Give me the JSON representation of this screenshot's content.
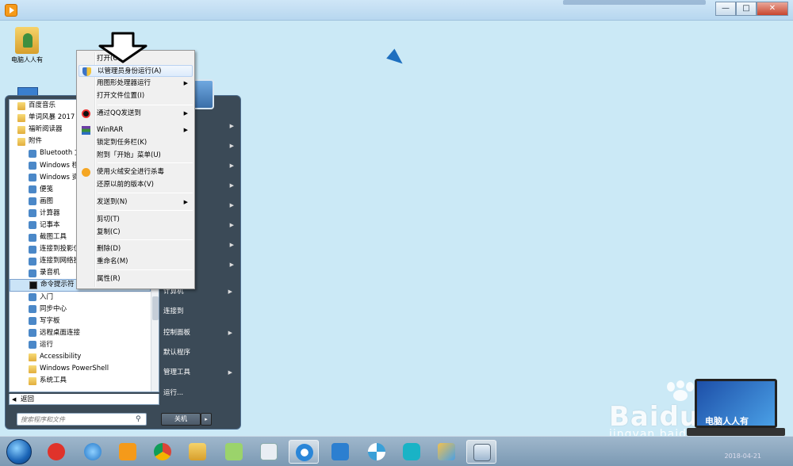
{
  "window": {
    "minimize_label": "—",
    "maximize_label": "□",
    "close_label": "✕"
  },
  "desktop": {
    "icon_label": "电脑人人有"
  },
  "start_menu": {
    "programs": [
      {
        "label": "百度音乐",
        "type": "folder",
        "level": 0
      },
      {
        "label": "单词风暴 2017",
        "type": "folder",
        "level": 0
      },
      {
        "label": "福昕阅读器",
        "type": "folder",
        "level": 0
      },
      {
        "label": "附件",
        "type": "folder",
        "level": 0
      },
      {
        "label": "Bluetooth 文",
        "type": "app",
        "level": 1
      },
      {
        "label": "Windows 移",
        "type": "app",
        "level": 1
      },
      {
        "label": "Windows 资",
        "type": "app",
        "level": 1
      },
      {
        "label": "便笺",
        "type": "app",
        "level": 1
      },
      {
        "label": "画图",
        "type": "app",
        "level": 1
      },
      {
        "label": "计算器",
        "type": "app",
        "level": 1
      },
      {
        "label": "记事本",
        "type": "app",
        "level": 1
      },
      {
        "label": "截图工具",
        "type": "app",
        "level": 1
      },
      {
        "label": "连接到投影仪",
        "type": "app",
        "level": 1
      },
      {
        "label": "连接到网络投",
        "type": "app",
        "level": 1
      },
      {
        "label": "录音机",
        "type": "app",
        "level": 1
      },
      {
        "label": "命令提示符",
        "type": "cmd",
        "level": 1,
        "selected": true
      },
      {
        "label": "入门",
        "type": "app",
        "level": 1
      },
      {
        "label": "同步中心",
        "type": "app",
        "level": 1
      },
      {
        "label": "写字板",
        "type": "app",
        "level": 1
      },
      {
        "label": "远程桌面连接",
        "type": "app",
        "level": 1
      },
      {
        "label": "运行",
        "type": "app",
        "level": 1
      },
      {
        "label": "Accessibility",
        "type": "folder",
        "level": 1
      },
      {
        "label": "Windows PowerShell",
        "type": "folder",
        "level": 1
      },
      {
        "label": "系统工具",
        "type": "folder",
        "level": 1
      }
    ],
    "back_label": "返回",
    "search_placeholder": "搜索程序和文件",
    "right_items": [
      {
        "label": "计算机",
        "submenu": true
      },
      {
        "label": "连接到",
        "submenu": false
      },
      {
        "label": "控制面板",
        "submenu": true
      },
      {
        "label": "默认程序",
        "submenu": false
      },
      {
        "label": "管理工具",
        "submenu": true
      },
      {
        "label": "运行...",
        "submenu": false
      }
    ],
    "shutdown_label": "关机",
    "shutdown_arrow": "▸"
  },
  "context_menu": {
    "items": [
      {
        "label": "打开(O)"
      },
      {
        "label": "以管理员身份运行(A)",
        "icon": "shield-icon",
        "highlighted": true
      },
      {
        "label": "用图形处理器运行",
        "submenu": true
      },
      {
        "label": "打开文件位置(I)"
      },
      {
        "label": "通过QQ发送到",
        "icon": "qq-icon",
        "submenu": true
      },
      {
        "label": "WinRAR",
        "icon": "winrar-icon",
        "submenu": true
      },
      {
        "label": "锁定到任务栏(K)"
      },
      {
        "label": "附到「开始」菜单(U)"
      },
      {
        "label": "使用火绒安全进行杀毒",
        "icon": "huorong-icon"
      },
      {
        "label": "还原以前的版本(V)"
      },
      {
        "label": "发送到(N)",
        "submenu": true
      },
      {
        "label": "剪切(T)"
      },
      {
        "label": "复制(C)"
      },
      {
        "label": "删除(D)"
      },
      {
        "label": "重命名(M)"
      },
      {
        "label": "属性(R)"
      }
    ]
  },
  "watermark": {
    "brand": "Baidu经验",
    "url": "jingyan.baidu.com",
    "monitor_text": "电脑人人有"
  },
  "taskbar": {
    "date": "2018-04-21"
  },
  "colors": {
    "desktop": "#cbe9f6",
    "start_menu": "#3b4a57",
    "highlight": "#dcebfc",
    "accent": "#1e6fbf"
  }
}
